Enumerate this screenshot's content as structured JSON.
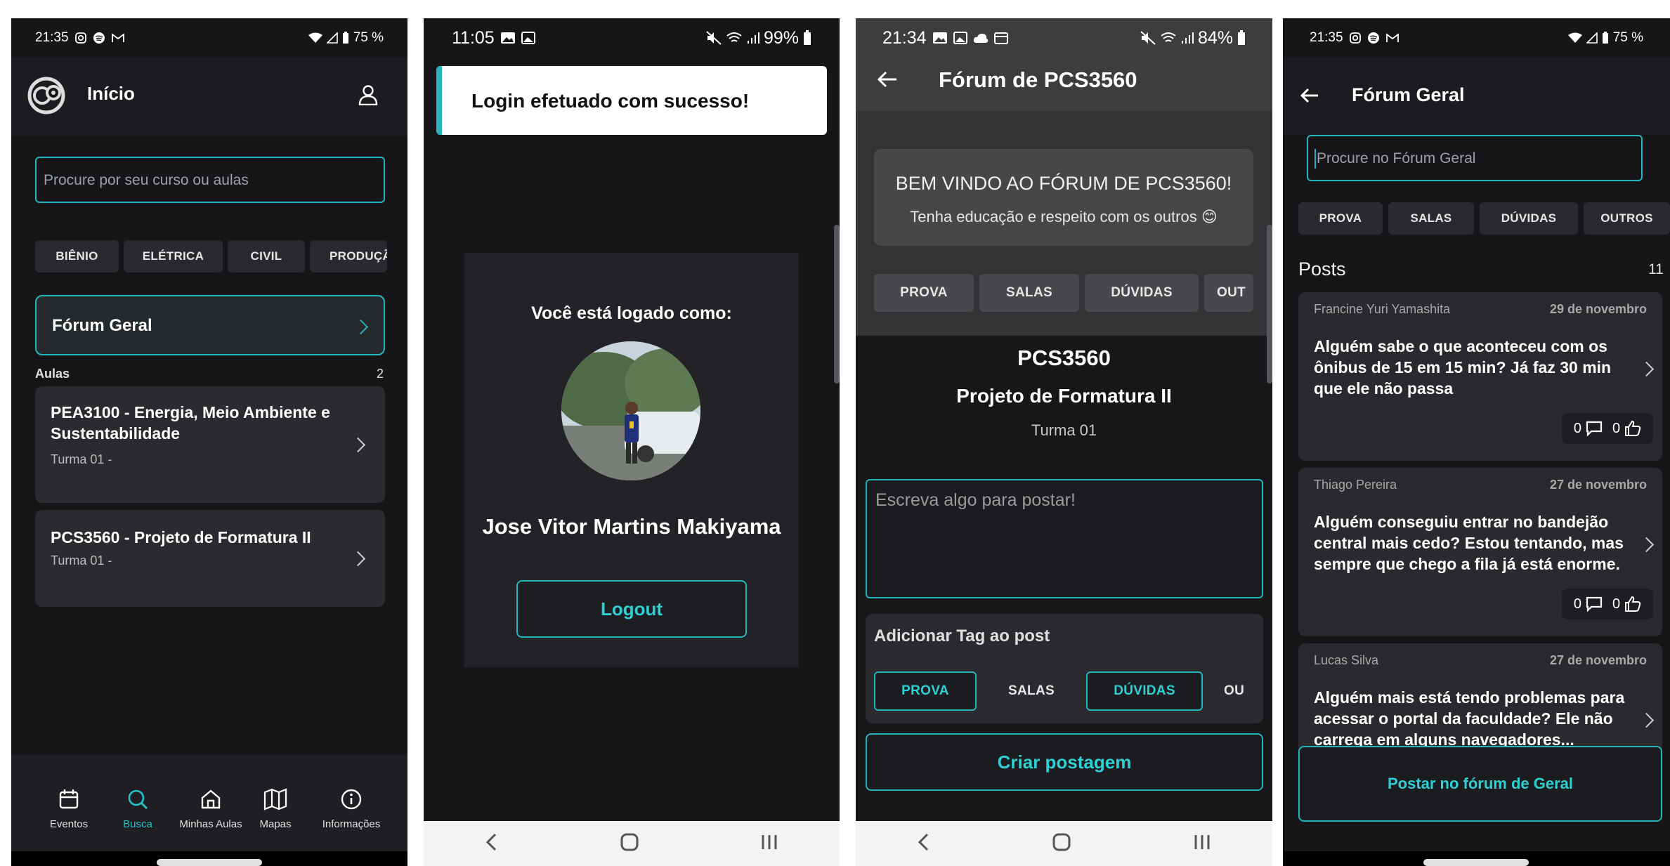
{
  "colors": {
    "accent": "#23b5b9",
    "bg": "#161619",
    "card": "#2b2b2f"
  },
  "screen1": {
    "status": {
      "time": "21:35",
      "battery": "75 %"
    },
    "title": "Início",
    "search_placeholder": "Procure por seu curso ou aulas",
    "filters": [
      "BIÊNIO",
      "ELÉTRICA",
      "CIVIL",
      "PRODUÇÃ"
    ],
    "forum_label": "Fórum Geral",
    "aulas_label": "Aulas",
    "aulas_count": "2",
    "classes": [
      {
        "name": "PEA3100 - Energia, Meio Ambiente e Sustentabilidade",
        "sub": "Turma 01 -"
      },
      {
        "name": "PCS3560 - Projeto de Formatura II",
        "sub": "Turma 01 -"
      }
    ],
    "nav": [
      {
        "label": "Eventos",
        "icon": "calendar-icon"
      },
      {
        "label": "Busca",
        "icon": "search-icon"
      },
      {
        "label": "Minhas Aulas",
        "icon": "home-icon"
      },
      {
        "label": "Mapas",
        "icon": "map-icon"
      },
      {
        "label": "Informações",
        "icon": "info-icon"
      }
    ]
  },
  "screen2": {
    "status": {
      "time": "11:05",
      "battery": "99%"
    },
    "toast": "Login efetuado com sucesso!",
    "logged_as": "Você está logado como:",
    "user_name": "Jose Vitor Martins Makiyama",
    "logout": "Logout"
  },
  "screen3": {
    "status": {
      "time": "21:34",
      "battery": "84%"
    },
    "title": "Fórum de PCS3560",
    "welcome_title": "BEM VINDO AO FÓRUM DE PCS3560!",
    "welcome_sub": "Tenha educação e respeito com os outros 😊",
    "filters": [
      "PROVA",
      "SALAS",
      "DÚVIDAS",
      "OUT"
    ],
    "course_code": "PCS3560",
    "course_name": "Projeto de Formatura II",
    "turma": "Turma 01",
    "post_placeholder": "Escreva algo para postar!",
    "tag_title": "Adicionar Tag ao post",
    "tags": [
      "PROVA",
      "SALAS",
      "DÚVIDAS",
      "OU"
    ],
    "create_button": "Criar postagem"
  },
  "screen4": {
    "status": {
      "time": "21:35",
      "battery": "75 %"
    },
    "title": "Fórum Geral",
    "search_placeholder": "Procure no Fórum Geral",
    "filters": [
      "PROVA",
      "SALAS",
      "DÚVIDAS",
      "OUTROS"
    ],
    "posts_label": "Posts",
    "posts_count": "11",
    "posts": [
      {
        "author": "Francine  Yuri Yamashita",
        "date": "29 de novembro",
        "text": "Alguém sabe o que aconteceu com os ônibus de 15 em 15 min? Já faz 30 min que ele não passa",
        "comments": "0",
        "likes": "0"
      },
      {
        "author": "Thiago Pereira",
        "date": "27 de novembro",
        "text": "Alguém conseguiu entrar no bandejão central mais cedo? Estou tentando, mas sempre que chego a fila já está enorme.",
        "comments": "0",
        "likes": "0"
      },
      {
        "author": "Lucas Silva",
        "date": "27 de novembro",
        "text": "Alguém mais está tendo problemas para acessar o portal da faculdade? Ele não carrega em alguns navegadores..."
      }
    ],
    "post_button": "Postar no fórum de Geral"
  }
}
